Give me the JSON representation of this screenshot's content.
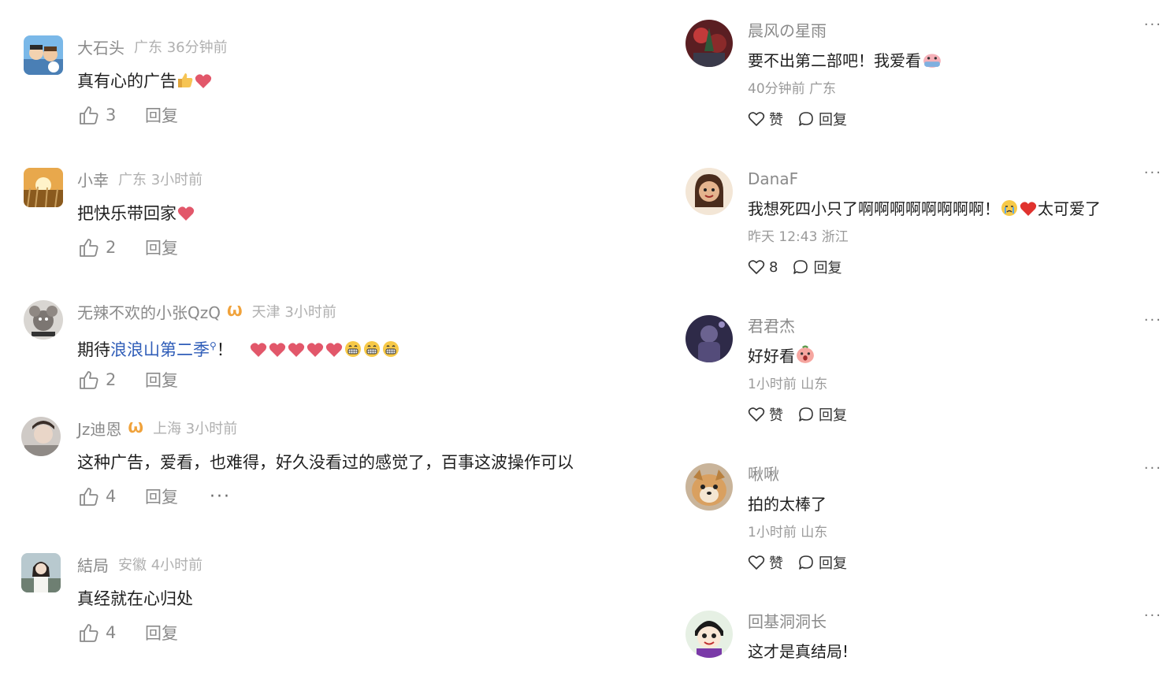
{
  "colors": {
    "username": "#8a8a8a",
    "location": "#b0b0b0",
    "link": "#2f5db8",
    "badge": "#f0a23b",
    "heart": "#e2576a"
  },
  "left_comments": [
    {
      "username": "大石头",
      "location": "广东 36分钟前",
      "text": "真有心的广告",
      "likes": "3",
      "reply": "回复",
      "emoji": [
        "thumbs-up-icon",
        "heart-icon"
      ]
    },
    {
      "username": "小幸",
      "location": "广东 3小时前",
      "text": "把快乐带回家",
      "likes": "2",
      "reply": "回复",
      "emoji": [
        "heart-icon"
      ]
    },
    {
      "username": "无辣不欢的小张QzQ",
      "location": "天津 3小时前",
      "text_before": "期待",
      "topic": "浪浪山第二季",
      "text_after": "！",
      "likes": "2",
      "reply": "回复",
      "emoji": [
        "heart-icon",
        "heart-icon",
        "heart-icon",
        "heart-icon",
        "heart-icon",
        "grin-icon",
        "grin-icon",
        "grin-icon"
      ]
    },
    {
      "username": "Jz迪恩",
      "location": "上海 3小时前",
      "text": "这种广告，爱看，也难得，好久没看过的感觉了，百事这波操作可以",
      "likes": "4",
      "reply": "回复",
      "more": "···"
    },
    {
      "username": "結局",
      "location": "安徽 4小时前",
      "text": "真经就在心归处",
      "likes": "4",
      "reply": "回复"
    }
  ],
  "right_comments": [
    {
      "username": "晨风の星雨",
      "text": "要不出第二部吧！我爱看",
      "meta": "40分钟前 广东",
      "like_label": "赞",
      "reply": "回复"
    },
    {
      "username": "DanaF",
      "text_before": "我想死四小只了啊啊啊啊啊啊啊啊！",
      "text_after": "太可爱了",
      "meta": "昨天 12:43 浙江",
      "like_label": "8",
      "reply": "回复"
    },
    {
      "username": "君君杰",
      "text": "好好看",
      "meta": "1小时前 山东",
      "like_label": "赞",
      "reply": "回复"
    },
    {
      "username": "啾啾",
      "text": "拍的太棒了",
      "meta": "1小时前 山东",
      "like_label": "赞",
      "reply": "回复"
    },
    {
      "username": "回基洞洞长",
      "text": "这才是真结局!",
      "meta": "",
      "like_label": "",
      "reply": ""
    }
  ],
  "more_icon": "···"
}
